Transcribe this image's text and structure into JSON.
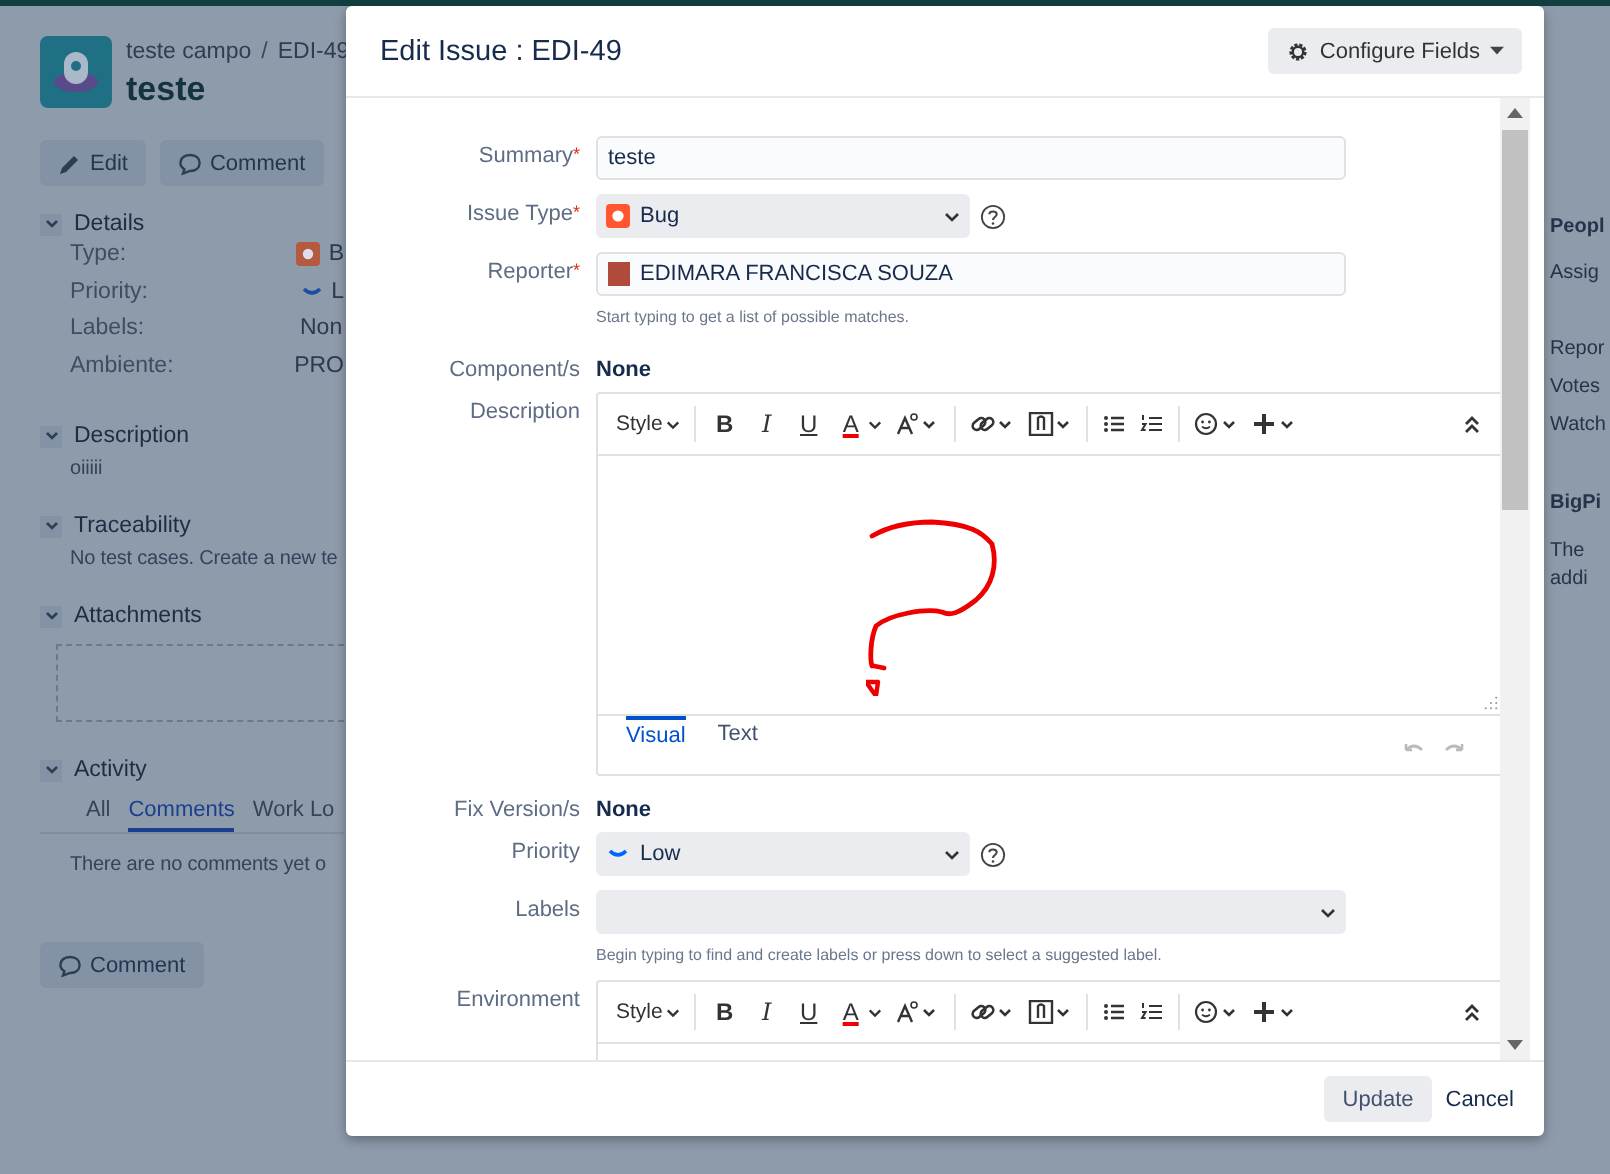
{
  "issue_page": {
    "breadcrumb": {
      "project": "teste campo",
      "separator": "/",
      "key": "EDI-49"
    },
    "title": "teste",
    "actions": [
      "Edit",
      "Comment"
    ],
    "details": {
      "heading": "Details",
      "rows": [
        {
          "label": "Type:",
          "value": "B"
        },
        {
          "label": "Priority:",
          "value": "L"
        },
        {
          "label": "Labels:",
          "value": "Non"
        },
        {
          "label": "Ambiente:",
          "value": "PRO"
        }
      ]
    },
    "description": {
      "heading": "Description",
      "text": "oiiiii"
    },
    "traceability": {
      "heading": "Traceability",
      "text": "No test cases. Create a new te"
    },
    "attachments": {
      "heading": "Attachments"
    },
    "activity": {
      "heading": "Activity",
      "tabs": [
        {
          "label": "All",
          "selected": false
        },
        {
          "label": "Comments",
          "selected": true
        },
        {
          "label": "Work Lo",
          "selected": false
        }
      ],
      "text": "There are no comments yet o"
    },
    "comment_button": "Comment",
    "side_panel": [
      {
        "text": "Peopl",
        "bold": true
      },
      {
        "text": "Assig",
        "bold": false
      },
      {
        "text": "Repor",
        "bold": false
      },
      {
        "text": "Votes",
        "bold": false
      },
      {
        "text": "Watch",
        "bold": false
      },
      {
        "text": "BigPi",
        "bold": true
      },
      {
        "text": "The",
        "bold": false
      },
      {
        "text": "addi",
        "bold": false
      }
    ]
  },
  "dialog": {
    "title": "Edit Issue : EDI-49",
    "configure_button": "Configure Fields",
    "fields": [
      {
        "kind": "text",
        "label": "Summary",
        "required_mark": "*",
        "value": "teste"
      },
      {
        "kind": "select",
        "label": "Issue Type",
        "required_mark": "*",
        "value": "Bug",
        "help": true
      },
      {
        "kind": "user",
        "label": "Reporter",
        "required_mark": "*",
        "value": "EDIMARA FRANCISCA SOUZA",
        "hint": "Start typing to get a list of possible matches."
      },
      {
        "kind": "readonly",
        "label": "Component/s",
        "value": "None"
      },
      {
        "kind": "editor",
        "label": "Description",
        "toolbar": {
          "style": "Style",
          "format": [
            "B",
            "I",
            "U",
            "A"
          ]
        },
        "tabs": [
          {
            "label": "Visual",
            "selected": true
          },
          {
            "label": "Text",
            "selected": false
          }
        ]
      },
      {
        "kind": "readonly",
        "label": "Fix Version/s",
        "value": "None"
      },
      {
        "kind": "select",
        "label": "Priority",
        "value": "Low",
        "help": true
      },
      {
        "kind": "multiselect",
        "label": "Labels",
        "hint": "Begin typing to find and create labels or press down to select a suggested label."
      },
      {
        "kind": "editor",
        "label": "Environment",
        "toolbar": {
          "style": "Style",
          "format": [
            "B",
            "I",
            "U",
            "A"
          ]
        }
      }
    ],
    "buttons": [
      {
        "label": "Update",
        "kind": "primary"
      },
      {
        "label": "Cancel",
        "kind": "link"
      }
    ]
  }
}
